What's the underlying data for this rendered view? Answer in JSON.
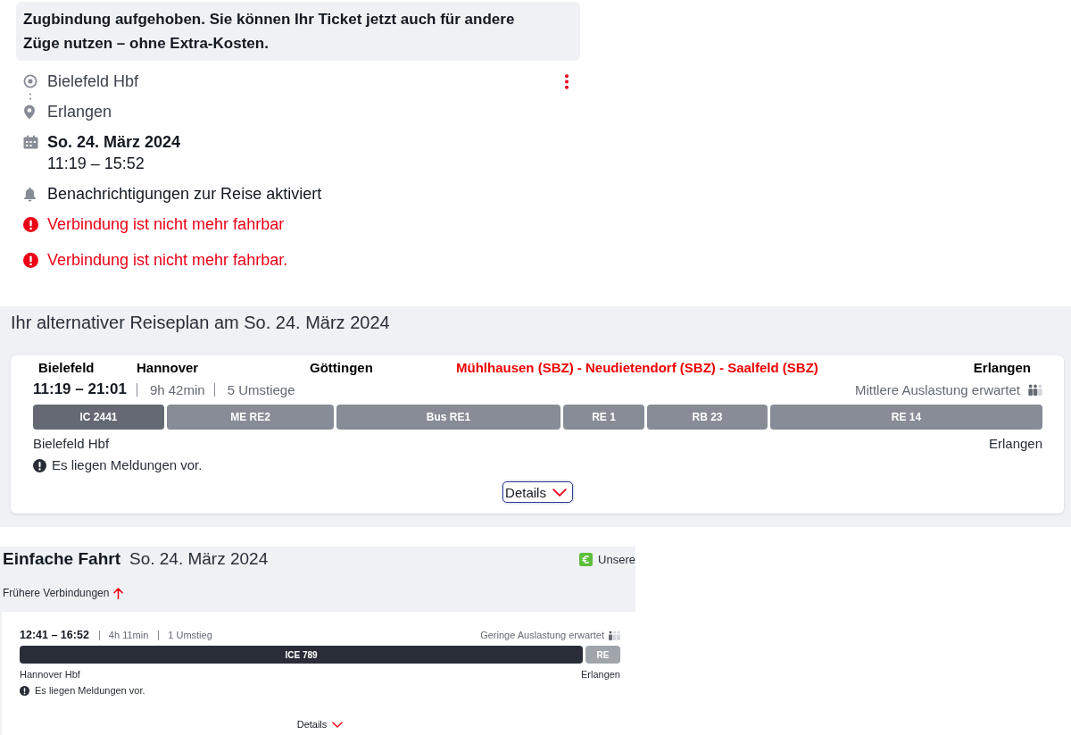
{
  "notice": {
    "text": "Zugbindung aufgehoben. Sie können Ihr Ticket jetzt auch für andere Züge nutzen – ohne Extra-Kosten."
  },
  "trip": {
    "origin": "Bielefeld Hbf",
    "destination": "Erlangen",
    "date": "So. 24. März 2024",
    "time": "11:19 – 15:52",
    "notification": "Benachrichtigungen zur Reise aktiviert",
    "alerts": [
      "Verbindung ist nicht mehr fahrbar",
      "Verbindung ist nicht mehr fahrbar."
    ]
  },
  "alternative_plan": {
    "title": "Ihr alternativer Reiseplan am So. 24. März 2024",
    "connection": {
      "stops": [
        {
          "label": "Bielefeld",
          "color": "#000000"
        },
        {
          "label": "Hannover",
          "color": "#000000"
        },
        {
          "label": "Göttingen",
          "color": "#000000"
        },
        {
          "label": "Mühlhausen (SBZ) - Neudietendorf (SBZ) - Saalfeld (SBZ)",
          "color": "#ee0000"
        },
        {
          "label": "Erlangen",
          "color": "#000000"
        }
      ],
      "time": "11:19 – 21:01",
      "duration": "9h 42min",
      "transfers": "5 Umstiege",
      "occupancy": {
        "label": "Mittlere Auslastung erwartet",
        "level": 0.67
      },
      "segments": [
        {
          "label": "IC 2441",
          "kind": "long_distance"
        },
        {
          "label": "ME RE2",
          "kind": "regional"
        },
        {
          "label": "Bus RE1",
          "kind": "regional"
        },
        {
          "label": "RE 1",
          "kind": "regional"
        },
        {
          "label": "RB 23",
          "kind": "regional"
        },
        {
          "label": "RE 14",
          "kind": "regional"
        }
      ],
      "origin": "Bielefeld Hbf",
      "destination": "Erlangen",
      "message": "Es liegen Meldungen vor.",
      "details": {
        "label": "Details",
        "focused": true
      }
    }
  },
  "search_results": {
    "title": "Einfache Fahrt",
    "date": "So. 24. März 2024",
    "offer": "Unsere",
    "earlier": "Frühere Verbindungen",
    "connections": [
      {
        "time": "12:41 – 16:52",
        "duration": "4h 11min",
        "transfers": "1 Umstieg",
        "occupancy": {
          "label": "Geringe Auslastung erwartet",
          "level": 0.33
        },
        "segments": [
          {
            "label": "ICE 789",
            "kind": "long_distance"
          },
          {
            "label": "RE",
            "kind": "regional"
          }
        ],
        "origin": "Hannover Hbf",
        "destination": "Erlangen",
        "message": "Es liegen Meldungen vor.",
        "details": {
          "label": "Details",
          "focused": false
        }
      }
    ]
  }
}
